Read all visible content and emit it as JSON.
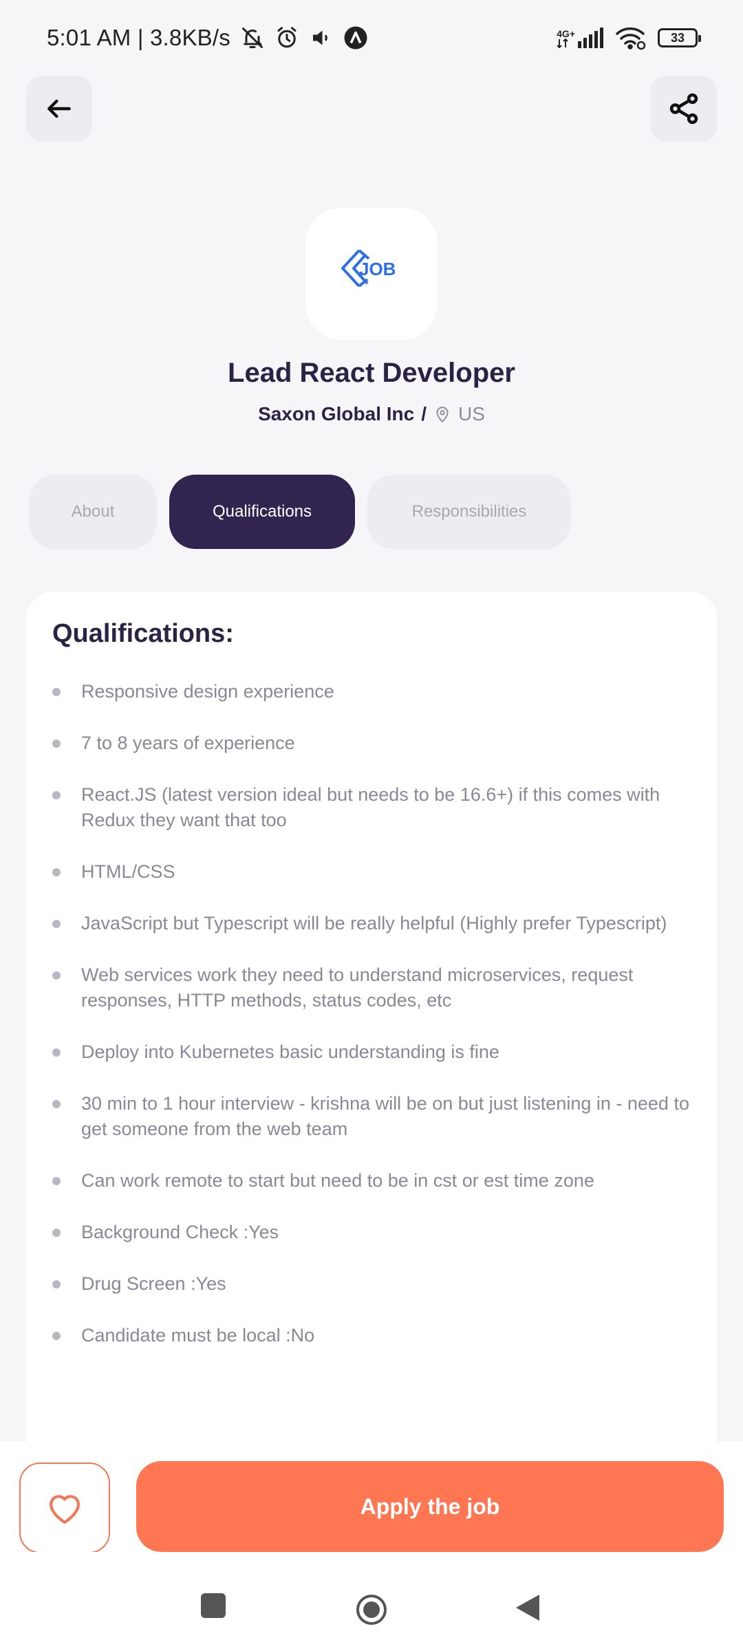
{
  "status_bar": {
    "time": "5:01 AM | 3.8KB/s",
    "network": "4G+",
    "battery": "33",
    "icons": [
      "bell-off-icon",
      "alarm-icon",
      "volume-icon",
      "app-a-icon",
      "signal-icon",
      "wifi-icon",
      "battery-icon"
    ]
  },
  "header": {
    "back_icon": "arrow-left-icon",
    "share_icon": "share-icon"
  },
  "job": {
    "logo_text": "JOB",
    "title": "Lead React Developer",
    "company": "Saxon Global Inc",
    "separator": "/",
    "location": "US"
  },
  "tabs": [
    {
      "label": "About",
      "active": false
    },
    {
      "label": "Qualifications",
      "active": true
    },
    {
      "label": "Responsibilities",
      "active": false
    }
  ],
  "qualifications": {
    "title": "Qualifications:",
    "items": [
      "Responsive design experience",
      "7 to 8 years of experience",
      "React.JS (latest version ideal but needs to be 16.6+) if this comes with Redux they want that too",
      "HTML/CSS",
      "JavaScript but Typescript will be really helpful (Highly prefer Typescript)",
      "Web services work they need to understand microservices, request responses, HTTP methods, status codes, etc",
      "Deploy into Kubernetes basic understanding is fine",
      "30 min to 1 hour interview - krishna will be on but just listening in - need to get someone from the web team",
      "Can work remote to start but need to be in cst or est time zone",
      "Background Check :Yes",
      "Drug Screen :Yes",
      "Candidate must be local :No"
    ]
  },
  "actions": {
    "favorite_icon": "heart-icon",
    "apply_label": "Apply the job"
  },
  "colors": {
    "primary": "#312450",
    "accent": "#FF7752",
    "logo_blue": "#2F6FE4"
  }
}
